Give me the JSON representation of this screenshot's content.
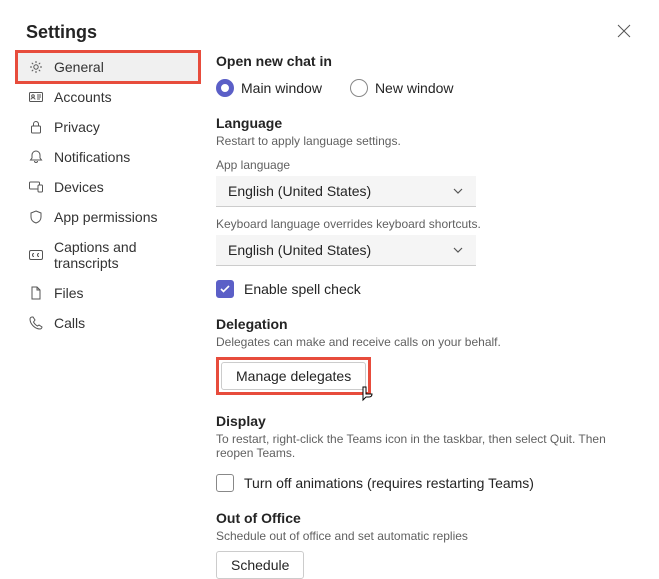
{
  "title": "Settings",
  "sidebar": {
    "items": [
      {
        "label": "General",
        "active": true
      },
      {
        "label": "Accounts"
      },
      {
        "label": "Privacy"
      },
      {
        "label": "Notifications"
      },
      {
        "label": "Devices"
      },
      {
        "label": "App permissions"
      },
      {
        "label": "Captions and transcripts"
      },
      {
        "label": "Files"
      },
      {
        "label": "Calls"
      }
    ]
  },
  "chat": {
    "heading": "Open new chat in",
    "opt_main": "Main window",
    "opt_new": "New window"
  },
  "language": {
    "heading": "Language",
    "hint": "Restart to apply language settings.",
    "app_lang_label": "App language",
    "app_lang_value": "English (United States)",
    "kb_hint": "Keyboard language overrides keyboard shortcuts.",
    "kb_value": "English (United States)",
    "spell_check": "Enable spell check"
  },
  "delegation": {
    "heading": "Delegation",
    "hint": "Delegates can make and receive calls on your behalf.",
    "manage": "Manage delegates"
  },
  "display": {
    "heading": "Display",
    "hint": "To restart, right-click the Teams icon in the taskbar, then select Quit. Then reopen Teams.",
    "turn_off": "Turn off animations (requires restarting Teams)"
  },
  "ooo": {
    "heading": "Out of Office",
    "hint": "Schedule out of office and set automatic replies",
    "schedule": "Schedule"
  }
}
